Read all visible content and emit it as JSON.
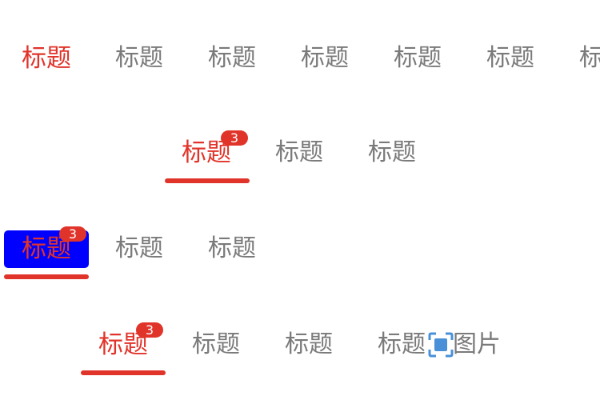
{
  "row1": {
    "tabs": [
      {
        "label": "标题",
        "active": true
      },
      {
        "label": "标题"
      },
      {
        "label": "标题"
      },
      {
        "label": "标题"
      },
      {
        "label": "标题"
      },
      {
        "label": "标题"
      },
      {
        "label": "标题"
      }
    ]
  },
  "row2": {
    "tabs": [
      {
        "label": "标题",
        "active": true,
        "badge": "3"
      },
      {
        "label": "标题"
      },
      {
        "label": "标题"
      }
    ]
  },
  "row3": {
    "tabs": [
      {
        "label": "标题",
        "active": true,
        "badge": "3"
      },
      {
        "label": "标题"
      },
      {
        "label": "标题"
      }
    ]
  },
  "row4": {
    "tabs": [
      {
        "label": "标题",
        "active": true,
        "badge": "3"
      },
      {
        "label": "标题"
      },
      {
        "label": "标题"
      },
      {
        "label": "标题"
      }
    ],
    "image_label": "图片",
    "image_icon": "image-placeholder-icon"
  },
  "colors": {
    "active": "#e0342a",
    "inactive": "#7a7a7a",
    "badge": "#e0342a",
    "highlight_box": "#0000ff",
    "icon": "#4a90d9"
  }
}
